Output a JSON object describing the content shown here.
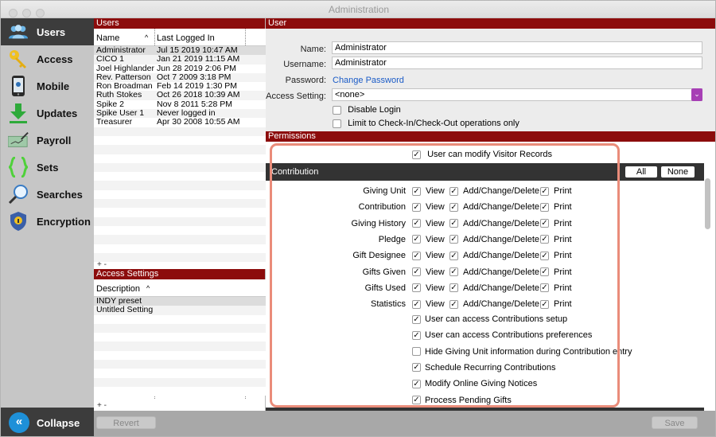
{
  "window": {
    "title": "Administration"
  },
  "sidebar": {
    "items": [
      {
        "label": "Users",
        "icon": "users-icon",
        "active": true
      },
      {
        "label": "Access",
        "icon": "key-icon",
        "active": false
      },
      {
        "label": "Mobile",
        "icon": "phone-icon",
        "active": false
      },
      {
        "label": "Updates",
        "icon": "download-arrow-icon",
        "active": false
      },
      {
        "label": "Payroll",
        "icon": "check-pen-icon",
        "active": false
      },
      {
        "label": "Sets",
        "icon": "braces-icon",
        "active": false
      },
      {
        "label": "Searches",
        "icon": "magnifier-icon",
        "active": false
      },
      {
        "label": "Encryption",
        "icon": "shield-icon",
        "active": false
      }
    ],
    "collapse_label": "Collapse"
  },
  "users_panel": {
    "title": "Users",
    "col_name": "Name",
    "sort_indicator": "^",
    "col_logged": "Last Logged In",
    "rows": [
      {
        "name": "Administrator",
        "logged": "Jul 15 2019 10:47 AM"
      },
      {
        "name": "CICO 1",
        "logged": "Jan 21 2019 11:15 AM"
      },
      {
        "name": "Joel Highlander",
        "logged": "Jun 28 2019 2:06 PM"
      },
      {
        "name": "Rev. Patterson",
        "logged": "Oct 7 2009 3:18 PM"
      },
      {
        "name": "Ron Broadman",
        "logged": "Feb 14 2019 1:30 PM"
      },
      {
        "name": "Ruth Stokes",
        "logged": "Oct 26 2018 10:39 AM"
      },
      {
        "name": "Spike 2",
        "logged": "Nov 8 2011 5:28 PM"
      },
      {
        "name": "Spike User 1",
        "logged": "Never logged in"
      },
      {
        "name": "Treasurer",
        "logged": "Apr 30 2008 10:55 AM"
      }
    ],
    "add_remove": "+  -"
  },
  "access_panel": {
    "title": "Access Settings",
    "col_desc": "Description",
    "sort_indicator": "^",
    "rows": [
      "INDY preset",
      "Untitled Setting"
    ],
    "add_remove": "+  -"
  },
  "user_panel": {
    "title": "User",
    "name_label": "Name:",
    "name_value": "Administrator",
    "username_label": "Username:",
    "username_value": "Administrator",
    "password_label": "Password:",
    "password_link": "Change Password",
    "access_label": "Access Setting:",
    "access_value": "<none>",
    "disable_login": "Disable Login",
    "limit_checkin": "Limit to Check-In/Check-Out operations only"
  },
  "permissions": {
    "title": "Permissions",
    "visitor_records": "User can modify Visitor Records",
    "section_title": "Contribution",
    "all_button": "All",
    "none_button": "None",
    "view_label": "View",
    "acd_label": "Add/Change/Delete",
    "print_label": "Print",
    "check_mark": "✓",
    "rows": [
      "Giving Unit",
      "Contribution",
      "Giving History",
      "Pledge",
      "Gift Designee",
      "Gifts Given",
      "Gifts Used",
      "Statistics"
    ],
    "options": [
      {
        "label": "User can access Contributions setup",
        "checked": true
      },
      {
        "label": "User can access Contributions preferences",
        "checked": true
      },
      {
        "label": "Hide Giving Unit information during Contribution entry",
        "checked": false
      },
      {
        "label": "Schedule Recurring Contributions",
        "checked": true
      },
      {
        "label": "Modify Online Giving Notices",
        "checked": true
      },
      {
        "label": "Process Pending Gifts",
        "checked": true
      }
    ]
  },
  "bottom": {
    "revert_label": "Revert",
    "save_label": "Save"
  },
  "colors": {
    "header_red": "#8c0c0c",
    "sidebar_active": "#3c3c3c",
    "highlight": "#ea8c7a",
    "link": "#1a5bc7"
  }
}
